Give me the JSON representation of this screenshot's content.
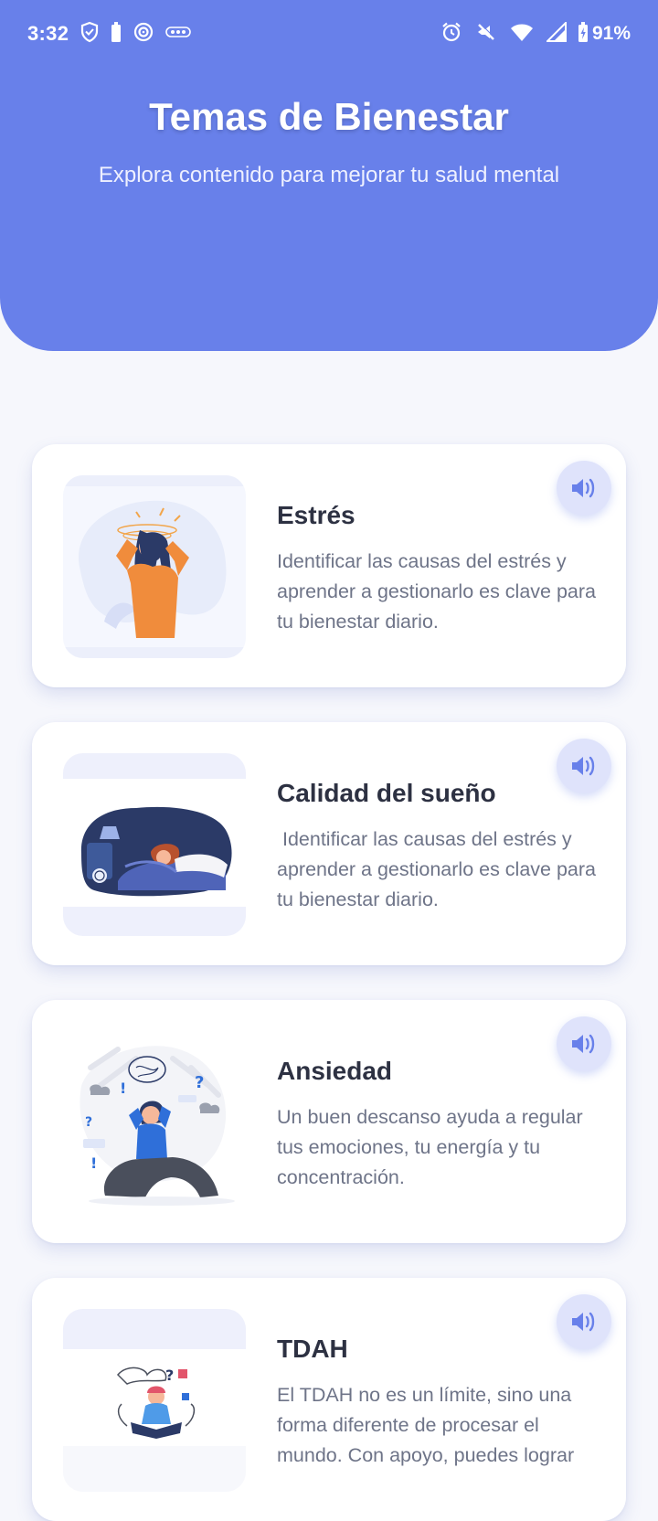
{
  "status_bar": {
    "time": "3:32",
    "battery": "91%"
  },
  "header": {
    "title": "Temas de Bienestar",
    "subtitle": "Explora contenido para mejorar tu salud mental"
  },
  "colors": {
    "header": "#6880ea",
    "background": "#f6f7fc",
    "card": "#ffffff",
    "title_text": "#2d3142",
    "body_text": "#6e7488",
    "audio_button": "#dfe3fb",
    "audio_icon": "#6880ea"
  },
  "topics": [
    {
      "title": "Estrés",
      "description": "Identificar las causas del estrés y aprender a gestionarlo es clave para tu bienestar diario.",
      "illustration": "stressed-woman-illustration",
      "action_icon": "speaker-icon"
    },
    {
      "title": "Calidad del sueño",
      "description": " Identificar las causas del estrés y aprender a gestionarlo es clave para tu bienestar diario.",
      "illustration": "sleeping-woman-illustration",
      "action_icon": "speaker-icon"
    },
    {
      "title": "Ansiedad",
      "description": "Un buen descanso ayuda a regular tus emociones, tu energía y tu concentración.",
      "illustration": "anxious-woman-illustration",
      "action_icon": "speaker-icon"
    },
    {
      "title": "TDAH",
      "description": "El TDAH no es un límite, sino una forma diferente de procesar el mundo. Con apoyo, puedes lograr",
      "illustration": "adhd-child-illustration",
      "action_icon": "speaker-icon"
    }
  ]
}
